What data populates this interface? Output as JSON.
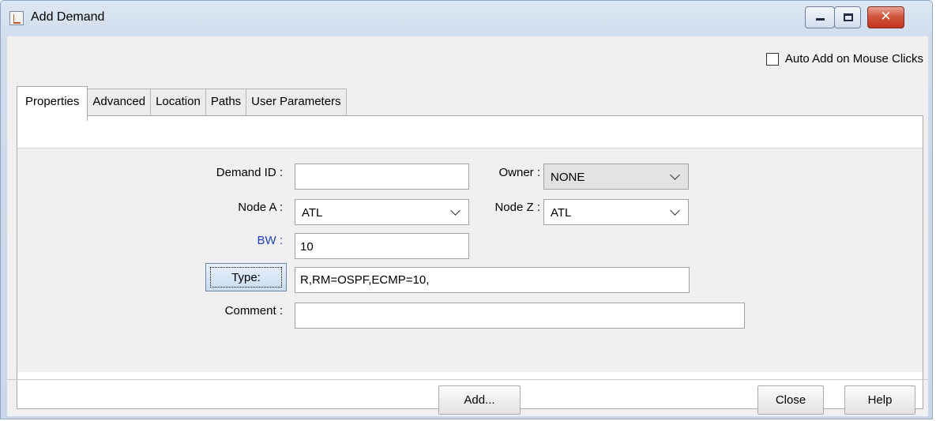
{
  "window": {
    "title": "Add Demand",
    "close_glyph": "✕"
  },
  "auto_add": {
    "label": "Auto Add on Mouse Clicks",
    "checked": false
  },
  "tabs": [
    {
      "label": "Properties",
      "active": true
    },
    {
      "label": "Advanced",
      "active": false
    },
    {
      "label": "Location",
      "active": false
    },
    {
      "label": "Paths",
      "active": false
    },
    {
      "label": "User Parameters",
      "active": false
    }
  ],
  "form": {
    "demand_id": {
      "label": "Demand ID :",
      "value": ""
    },
    "owner": {
      "label": "Owner :",
      "value": "NONE"
    },
    "node_a": {
      "label": "Node A :",
      "value": "ATL"
    },
    "node_z": {
      "label": "Node Z :",
      "value": "ATL"
    },
    "bw": {
      "label": "BW :",
      "value": "10",
      "label_color": "#1f3fbf"
    },
    "type": {
      "button_label": "Type:",
      "value": "R,RM=OSPF,ECMP=10,"
    },
    "comment": {
      "label": "Comment :",
      "value": ""
    }
  },
  "buttons": {
    "add": "Add...",
    "close": "Close",
    "help": "Help"
  }
}
